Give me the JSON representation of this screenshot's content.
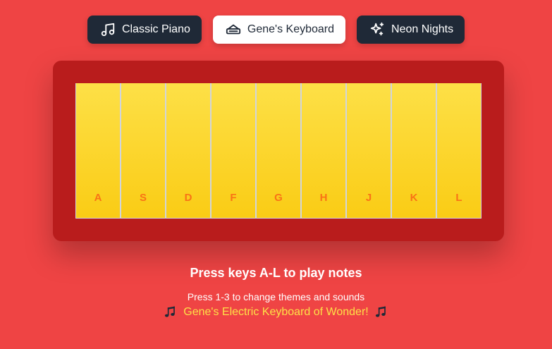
{
  "themes": [
    {
      "label": "Classic Piano",
      "icon": "music-note-icon",
      "active": false
    },
    {
      "label": "Gene's Keyboard",
      "icon": "keyboard-icon",
      "active": true
    },
    {
      "label": "Neon Nights",
      "icon": "sparkles-icon",
      "active": false
    }
  ],
  "keys": [
    "A",
    "S",
    "D",
    "F",
    "G",
    "H",
    "J",
    "K",
    "L"
  ],
  "instructions": {
    "title": "Press keys A-L to play notes",
    "subtitle": "Press 1-3 to change themes and sounds",
    "tagline": "Gene's Electric Keyboard of Wonder!"
  },
  "colors": {
    "background": "#ef4444",
    "frame": "#b91c1c",
    "key_top": "#fde047",
    "key_bottom": "#facc15",
    "key_label": "#f97316",
    "tagline": "#fde047",
    "dark_button": "#1f2937"
  }
}
